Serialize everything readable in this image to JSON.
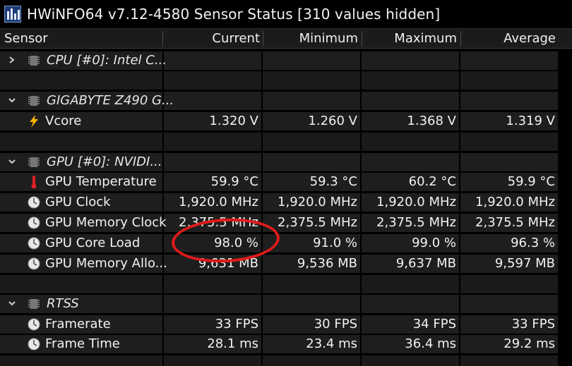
{
  "window": {
    "title": "HWiNFO64 v7.12-4580 Sensor Status [310 values hidden]"
  },
  "columns": {
    "sensor": "Sensor",
    "current": "Current",
    "minimum": "Minimum",
    "maximum": "Maximum",
    "average": "Average"
  },
  "groups": {
    "cpu": {
      "name": "CPU [#0]: Intel C...",
      "expanded": false,
      "icon": "chip-icon"
    },
    "mobo": {
      "name": "GIGABYTE Z490 G...",
      "expanded": true,
      "icon": "chip-icon",
      "items": [
        {
          "label": "Vcore",
          "icon": "lightning-bolt-icon",
          "current": "1.320 V",
          "minimum": "1.260 V",
          "maximum": "1.368 V",
          "average": "1.319 V"
        }
      ]
    },
    "gpu": {
      "name": "GPU [#0]: NVIDI...",
      "expanded": true,
      "icon": "chip-icon",
      "items": [
        {
          "label": "GPU Temperature",
          "icon": "thermometer-icon",
          "current": "59.9 °C",
          "minimum": "59.3 °C",
          "maximum": "60.2 °C",
          "average": "59.9 °C"
        },
        {
          "label": "GPU Clock",
          "icon": "clock-icon",
          "current": "1,920.0 MHz",
          "minimum": "1,920.0 MHz",
          "maximum": "1,920.0 MHz",
          "average": "1,920.0 MHz"
        },
        {
          "label": "GPU Memory Clock",
          "icon": "clock-icon",
          "current": "2,375.5 MHz",
          "minimum": "2,375.5 MHz",
          "maximum": "2,375.5 MHz",
          "average": "2,375.5 MHz"
        },
        {
          "label": "GPU Core Load",
          "icon": "clock-icon",
          "current": "98.0 %",
          "minimum": "91.0 %",
          "maximum": "99.0 %",
          "average": "96.3 %"
        },
        {
          "label": "GPU Memory Allo...",
          "icon": "clock-icon",
          "current": "9,631 MB",
          "minimum": "9,536 MB",
          "maximum": "9,637 MB",
          "average": "9,597 MB"
        }
      ]
    },
    "rtss": {
      "name": "RTSS",
      "expanded": true,
      "icon": "chip-icon",
      "items": [
        {
          "label": "Framerate",
          "icon": "clock-icon",
          "current": "33 FPS",
          "minimum": "30 FPS",
          "maximum": "34 FPS",
          "average": "33 FPS"
        },
        {
          "label": "Frame Time",
          "icon": "clock-icon",
          "current": "28.1 ms",
          "minimum": "23.4 ms",
          "maximum": "36.4 ms",
          "average": "29.2 ms"
        }
      ]
    }
  },
  "colors": {
    "background": "#000000",
    "cell": "#1e1e1e",
    "text": "#f2f2f2",
    "highlight": "#e01a1a"
  }
}
